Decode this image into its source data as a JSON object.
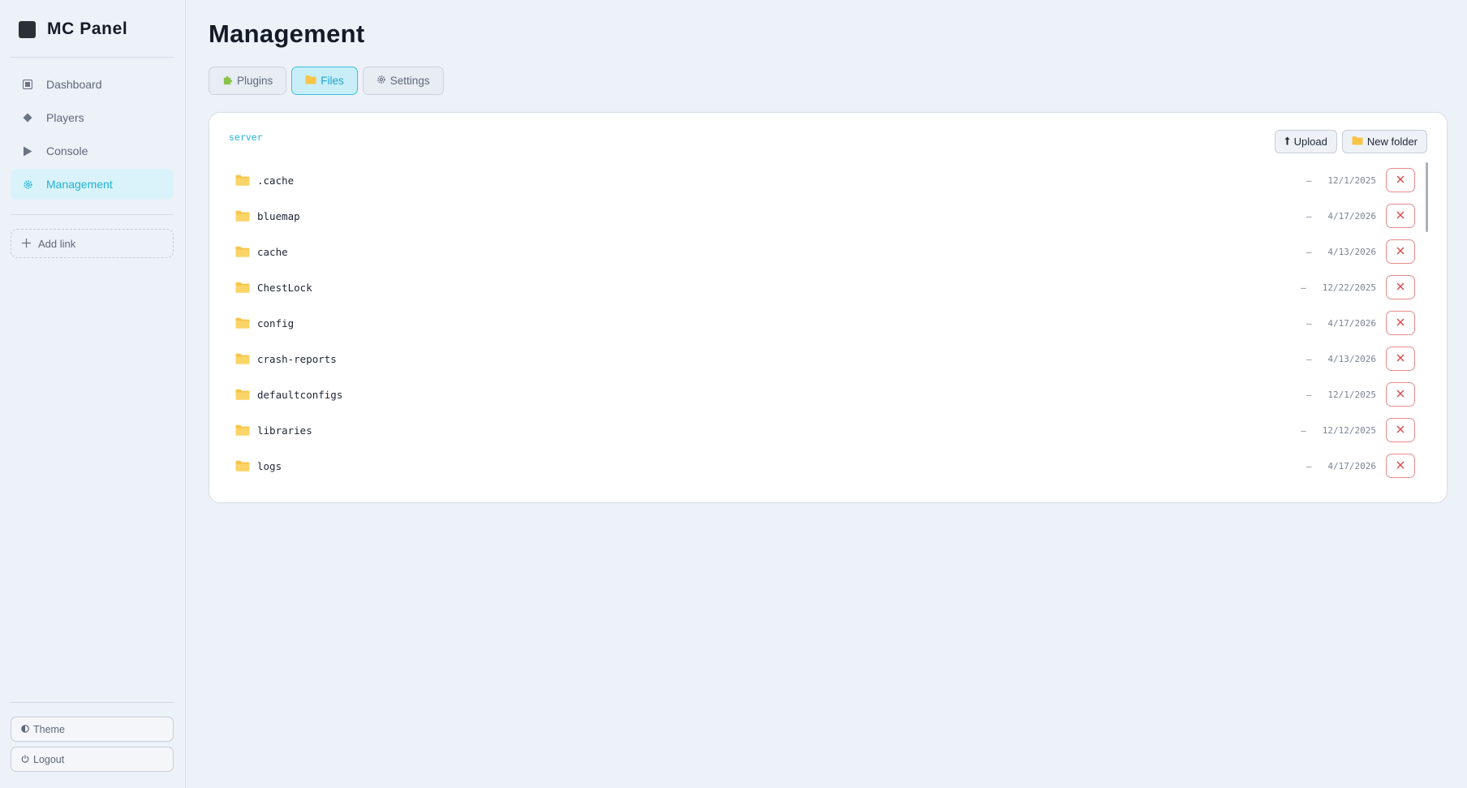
{
  "brand": {
    "name": "MC Panel"
  },
  "nav": {
    "items": [
      {
        "label": "Dashboard",
        "icon": "dashboard-square-icon",
        "active": false
      },
      {
        "label": "Players",
        "icon": "diamond-icon",
        "active": false
      },
      {
        "label": "Console",
        "icon": "play-triangle-icon",
        "active": false
      },
      {
        "label": "Management",
        "icon": "gear-icon",
        "active": true
      }
    ],
    "add_link": "Add link"
  },
  "sidebar_footer": {
    "theme_label": "Theme",
    "logout_label": "Logout"
  },
  "page": {
    "title": "Management"
  },
  "tabs": [
    {
      "label": "Plugins",
      "icon": "puzzle-icon",
      "active": false
    },
    {
      "label": "Files",
      "icon": "folder-icon",
      "active": true
    },
    {
      "label": "Settings",
      "icon": "gear-icon",
      "active": false
    }
  ],
  "files": {
    "path": "server",
    "upload_label": "Upload",
    "new_folder_label": "New folder",
    "items": [
      {
        "name": ".cache",
        "size": "—",
        "date": "12/1/2025"
      },
      {
        "name": "bluemap",
        "size": "—",
        "date": "4/17/2026"
      },
      {
        "name": "cache",
        "size": "—",
        "date": "4/13/2026"
      },
      {
        "name": "ChestLock",
        "size": "—",
        "date": "12/22/2025"
      },
      {
        "name": "config",
        "size": "—",
        "date": "4/17/2026"
      },
      {
        "name": "crash-reports",
        "size": "—",
        "date": "4/13/2026"
      },
      {
        "name": "defaultconfigs",
        "size": "—",
        "date": "12/1/2025"
      },
      {
        "name": "libraries",
        "size": "—",
        "date": "12/12/2025"
      },
      {
        "name": "logs",
        "size": "—",
        "date": "4/17/2026"
      }
    ]
  },
  "colors": {
    "accent": "#1fb3d3",
    "folder": "#f7c448",
    "danger": "#d94848",
    "background": "#edf1f8"
  }
}
